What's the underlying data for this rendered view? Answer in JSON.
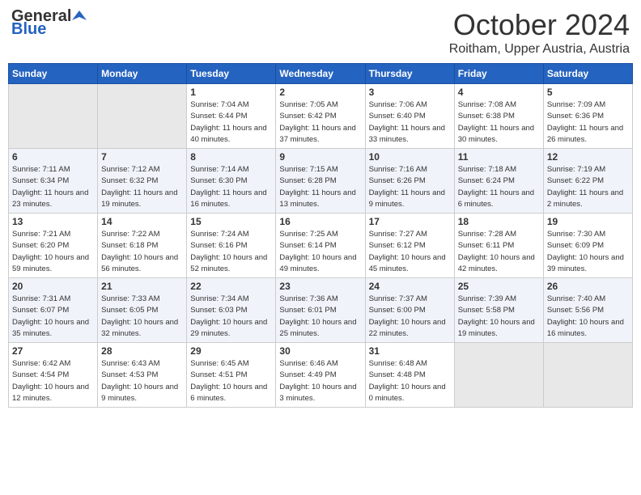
{
  "header": {
    "logo_general": "General",
    "logo_blue": "Blue",
    "month_title": "October 2024",
    "location": "Roitham, Upper Austria, Austria"
  },
  "days_of_week": [
    "Sunday",
    "Monday",
    "Tuesday",
    "Wednesday",
    "Thursday",
    "Friday",
    "Saturday"
  ],
  "weeks": [
    [
      {
        "day": "",
        "info": ""
      },
      {
        "day": "",
        "info": ""
      },
      {
        "day": "1",
        "info": "Sunrise: 7:04 AM\nSunset: 6:44 PM\nDaylight: 11 hours and 40 minutes."
      },
      {
        "day": "2",
        "info": "Sunrise: 7:05 AM\nSunset: 6:42 PM\nDaylight: 11 hours and 37 minutes."
      },
      {
        "day": "3",
        "info": "Sunrise: 7:06 AM\nSunset: 6:40 PM\nDaylight: 11 hours and 33 minutes."
      },
      {
        "day": "4",
        "info": "Sunrise: 7:08 AM\nSunset: 6:38 PM\nDaylight: 11 hours and 30 minutes."
      },
      {
        "day": "5",
        "info": "Sunrise: 7:09 AM\nSunset: 6:36 PM\nDaylight: 11 hours and 26 minutes."
      }
    ],
    [
      {
        "day": "6",
        "info": "Sunrise: 7:11 AM\nSunset: 6:34 PM\nDaylight: 11 hours and 23 minutes."
      },
      {
        "day": "7",
        "info": "Sunrise: 7:12 AM\nSunset: 6:32 PM\nDaylight: 11 hours and 19 minutes."
      },
      {
        "day": "8",
        "info": "Sunrise: 7:14 AM\nSunset: 6:30 PM\nDaylight: 11 hours and 16 minutes."
      },
      {
        "day": "9",
        "info": "Sunrise: 7:15 AM\nSunset: 6:28 PM\nDaylight: 11 hours and 13 minutes."
      },
      {
        "day": "10",
        "info": "Sunrise: 7:16 AM\nSunset: 6:26 PM\nDaylight: 11 hours and 9 minutes."
      },
      {
        "day": "11",
        "info": "Sunrise: 7:18 AM\nSunset: 6:24 PM\nDaylight: 11 hours and 6 minutes."
      },
      {
        "day": "12",
        "info": "Sunrise: 7:19 AM\nSunset: 6:22 PM\nDaylight: 11 hours and 2 minutes."
      }
    ],
    [
      {
        "day": "13",
        "info": "Sunrise: 7:21 AM\nSunset: 6:20 PM\nDaylight: 10 hours and 59 minutes."
      },
      {
        "day": "14",
        "info": "Sunrise: 7:22 AM\nSunset: 6:18 PM\nDaylight: 10 hours and 56 minutes."
      },
      {
        "day": "15",
        "info": "Sunrise: 7:24 AM\nSunset: 6:16 PM\nDaylight: 10 hours and 52 minutes."
      },
      {
        "day": "16",
        "info": "Sunrise: 7:25 AM\nSunset: 6:14 PM\nDaylight: 10 hours and 49 minutes."
      },
      {
        "day": "17",
        "info": "Sunrise: 7:27 AM\nSunset: 6:12 PM\nDaylight: 10 hours and 45 minutes."
      },
      {
        "day": "18",
        "info": "Sunrise: 7:28 AM\nSunset: 6:11 PM\nDaylight: 10 hours and 42 minutes."
      },
      {
        "day": "19",
        "info": "Sunrise: 7:30 AM\nSunset: 6:09 PM\nDaylight: 10 hours and 39 minutes."
      }
    ],
    [
      {
        "day": "20",
        "info": "Sunrise: 7:31 AM\nSunset: 6:07 PM\nDaylight: 10 hours and 35 minutes."
      },
      {
        "day": "21",
        "info": "Sunrise: 7:33 AM\nSunset: 6:05 PM\nDaylight: 10 hours and 32 minutes."
      },
      {
        "day": "22",
        "info": "Sunrise: 7:34 AM\nSunset: 6:03 PM\nDaylight: 10 hours and 29 minutes."
      },
      {
        "day": "23",
        "info": "Sunrise: 7:36 AM\nSunset: 6:01 PM\nDaylight: 10 hours and 25 minutes."
      },
      {
        "day": "24",
        "info": "Sunrise: 7:37 AM\nSunset: 6:00 PM\nDaylight: 10 hours and 22 minutes."
      },
      {
        "day": "25",
        "info": "Sunrise: 7:39 AM\nSunset: 5:58 PM\nDaylight: 10 hours and 19 minutes."
      },
      {
        "day": "26",
        "info": "Sunrise: 7:40 AM\nSunset: 5:56 PM\nDaylight: 10 hours and 16 minutes."
      }
    ],
    [
      {
        "day": "27",
        "info": "Sunrise: 6:42 AM\nSunset: 4:54 PM\nDaylight: 10 hours and 12 minutes."
      },
      {
        "day": "28",
        "info": "Sunrise: 6:43 AM\nSunset: 4:53 PM\nDaylight: 10 hours and 9 minutes."
      },
      {
        "day": "29",
        "info": "Sunrise: 6:45 AM\nSunset: 4:51 PM\nDaylight: 10 hours and 6 minutes."
      },
      {
        "day": "30",
        "info": "Sunrise: 6:46 AM\nSunset: 4:49 PM\nDaylight: 10 hours and 3 minutes."
      },
      {
        "day": "31",
        "info": "Sunrise: 6:48 AM\nSunset: 4:48 PM\nDaylight: 10 hours and 0 minutes."
      },
      {
        "day": "",
        "info": ""
      },
      {
        "day": "",
        "info": ""
      }
    ]
  ]
}
